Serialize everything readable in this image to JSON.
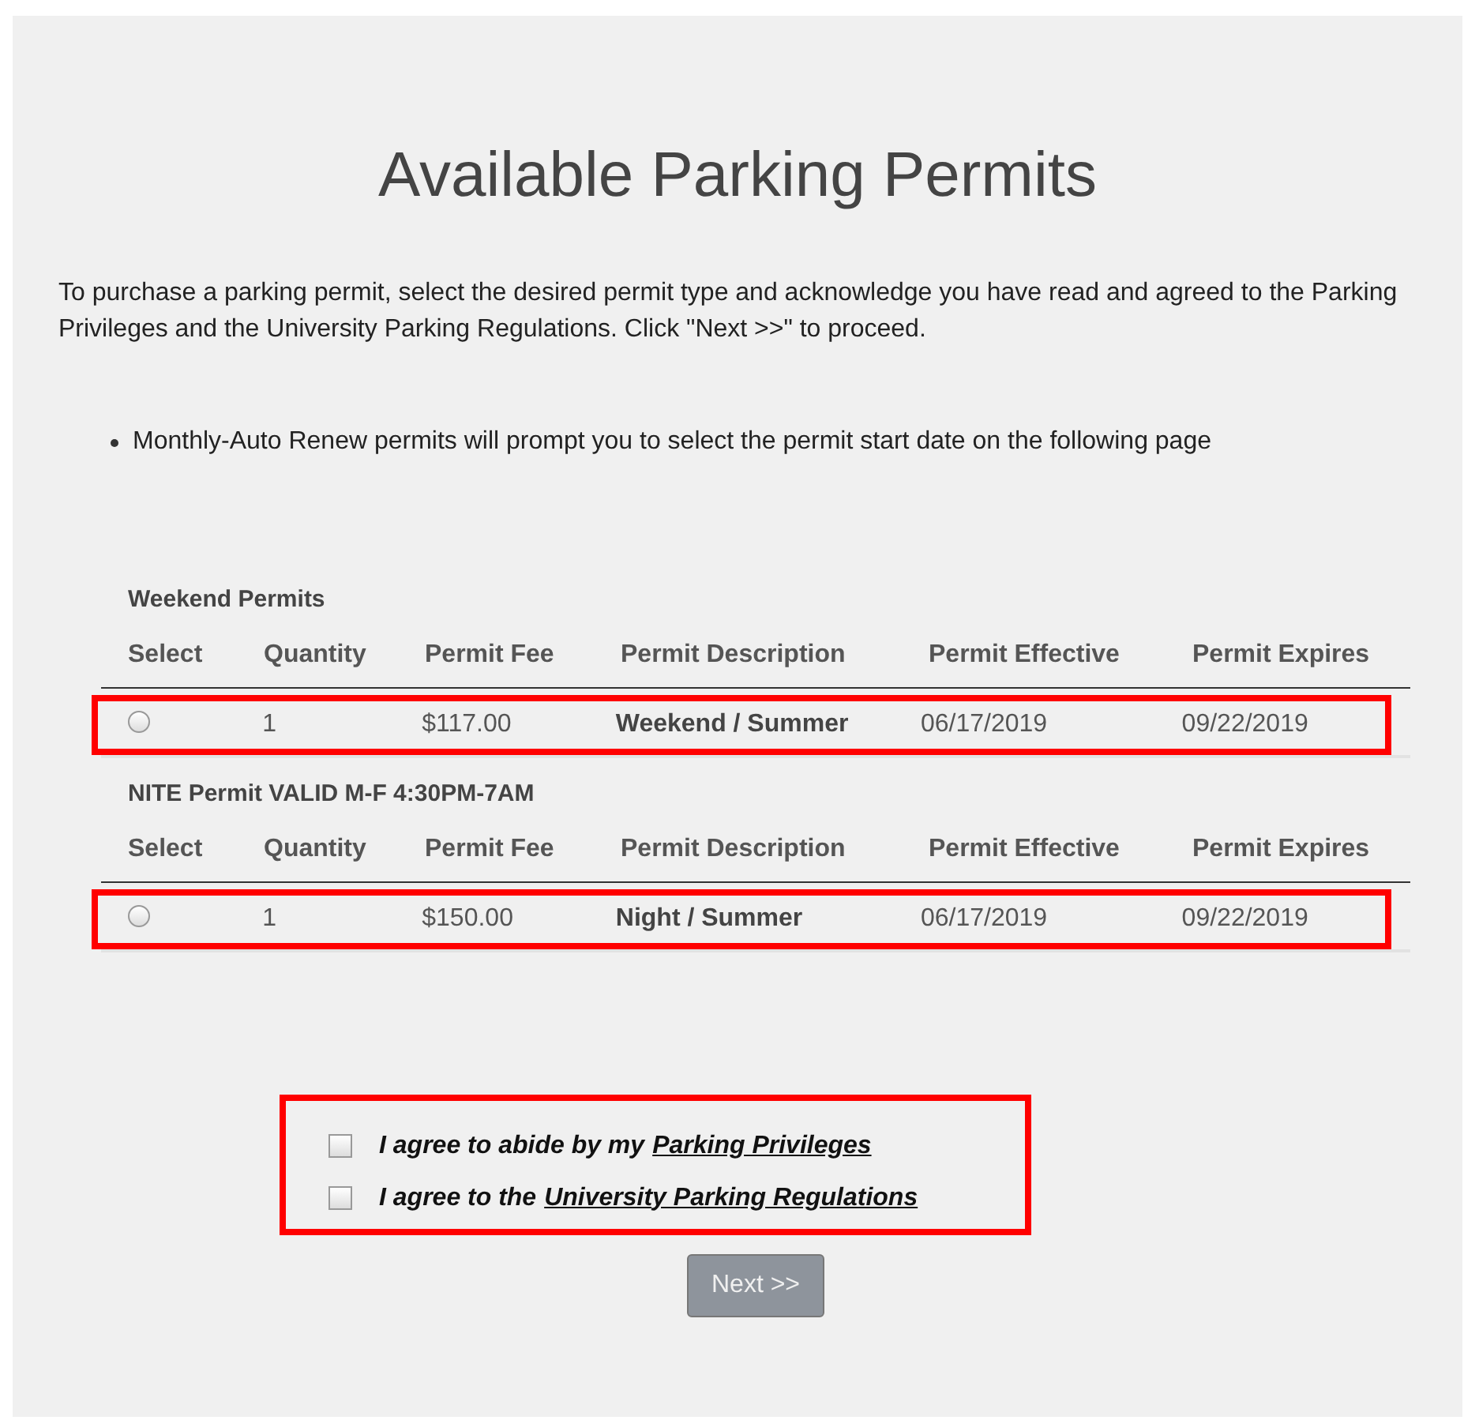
{
  "title": "Available Parking Permits",
  "intro": "To purchase a parking permit, select the desired permit type and acknowledge you have read and agreed to the Parking Privileges and the University Parking Regulations. Click \"Next >>\" to proceed.",
  "notes": [
    "Monthly-Auto Renew permits will prompt you to select the permit start date on the following page"
  ],
  "permit_groups": [
    {
      "heading": "Weekend Permits",
      "columns": [
        "Select",
        "Quantity",
        "Permit Fee",
        "Permit Description",
        "Permit Effective",
        "Permit Expires"
      ],
      "rows": [
        {
          "selected": false,
          "highlighted": true,
          "quantity": "1",
          "fee": "$117.00",
          "description": "Weekend / Summer",
          "effective": "06/17/2019",
          "expires": "09/22/2019"
        }
      ]
    },
    {
      "heading": "NITE Permit VALID M-F 4:30PM-7AM",
      "columns": [
        "Select",
        "Quantity",
        "Permit Fee",
        "Permit Description",
        "Permit Effective",
        "Permit Expires"
      ],
      "rows": [
        {
          "selected": false,
          "highlighted": true,
          "quantity": "1",
          "fee": "$150.00",
          "description": "Night / Summer",
          "effective": "06/17/2019",
          "expires": "09/22/2019"
        }
      ]
    }
  ],
  "agreements": {
    "highlighted": true,
    "items": [
      {
        "checked": false,
        "text": "I agree to abide by my",
        "link": "Parking Privileges"
      },
      {
        "checked": false,
        "text": "I agree to the",
        "link": "University Parking Regulations"
      }
    ]
  },
  "next_button": {
    "label": "Next >>",
    "disabled": true
  }
}
